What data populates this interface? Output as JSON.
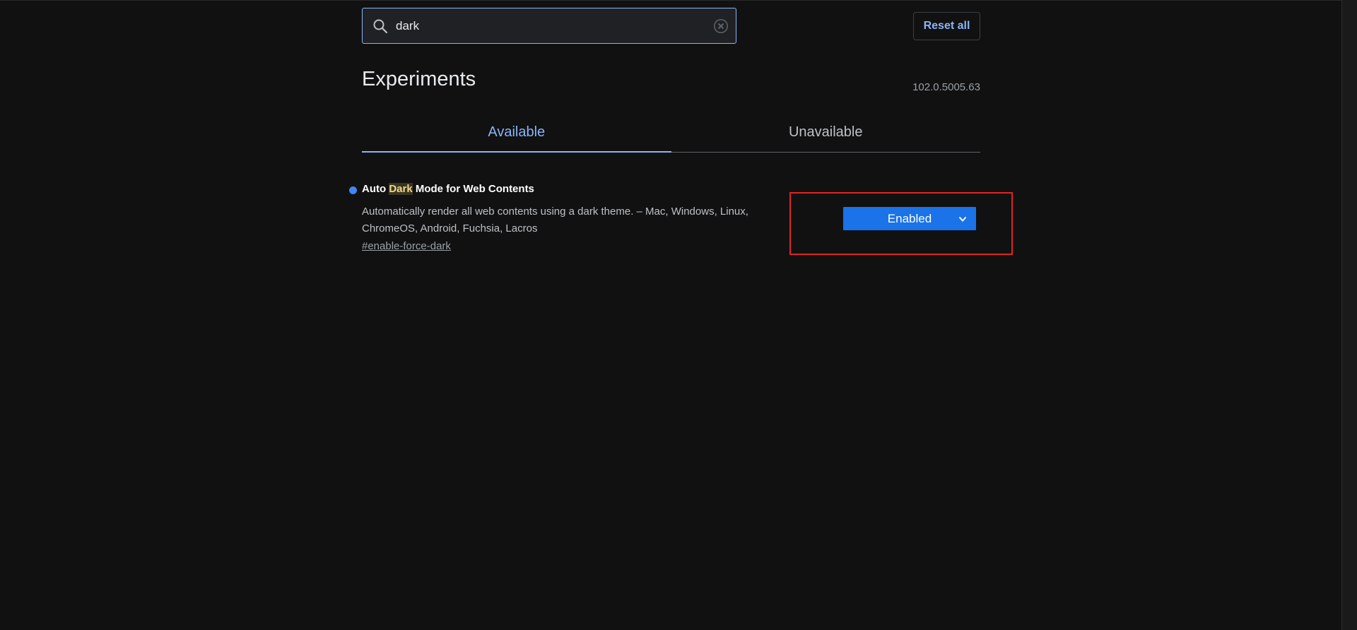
{
  "search": {
    "value": "dark",
    "placeholder": "Search flags"
  },
  "toolbar": {
    "reset_label": "Reset all"
  },
  "header": {
    "title": "Experiments",
    "version": "102.0.5005.63"
  },
  "tabs": [
    {
      "label": "Available",
      "active": true
    },
    {
      "label": "Unavailable",
      "active": false
    }
  ],
  "experiment": {
    "title_before": "Auto ",
    "title_highlight": "Dark",
    "title_after": " Mode for Web Contents",
    "description": "Automatically render all web contents using a dark theme. – Mac, Windows, Linux, ChromeOS, Android, Fuchsia, Lacros",
    "link": "#enable-force-dark",
    "selected_option": "Enabled"
  },
  "colors": {
    "accent": "#8ab4f8",
    "select_bg": "#1a73e8",
    "annotation_border": "#e02424",
    "bullet": "#4285f4"
  },
  "icons": [
    "search-icon",
    "clear-icon",
    "chevron-down-icon"
  ]
}
